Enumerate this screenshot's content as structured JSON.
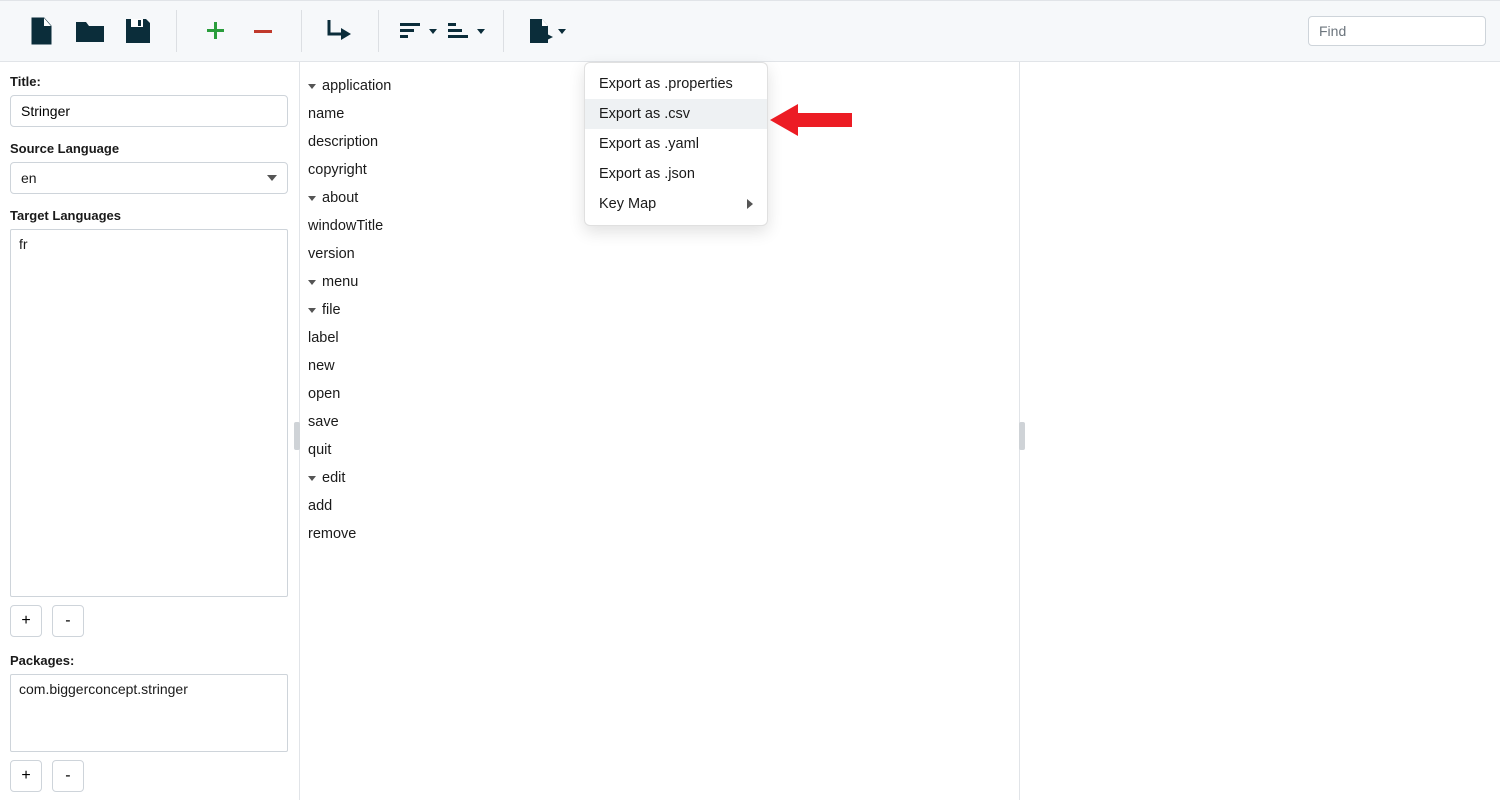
{
  "toolbar": {
    "find_placeholder": "Find"
  },
  "sidebar": {
    "title_label": "Title:",
    "title_value": "Stringer",
    "source_lang_label": "Source Language",
    "source_lang_value": "en",
    "target_lang_label": "Target Languages",
    "target_lang_items": [
      "fr"
    ],
    "add_label": "+",
    "remove_label": "-",
    "packages_label": "Packages:",
    "packages_items": [
      "com.biggerconcept.stringer"
    ]
  },
  "tree": {
    "items": [
      {
        "label": "application",
        "indent": "indent-0",
        "caret": true
      },
      {
        "label": "name",
        "indent": "indent-1",
        "caret": false
      },
      {
        "label": "description",
        "indent": "indent-1",
        "caret": false
      },
      {
        "label": "copyright",
        "indent": "indent-1",
        "caret": false
      },
      {
        "label": "about",
        "indent": "indent-1c",
        "caret": true
      },
      {
        "label": "windowTitle",
        "indent": "indent-2",
        "caret": false
      },
      {
        "label": "version",
        "indent": "indent-1",
        "caret": false
      },
      {
        "label": "menu",
        "indent": "indent-0",
        "caret": true
      },
      {
        "label": "file",
        "indent": "indent-1c",
        "caret": true
      },
      {
        "label": "label",
        "indent": "indent-2",
        "caret": false
      },
      {
        "label": "new",
        "indent": "indent-2",
        "caret": false
      },
      {
        "label": "open",
        "indent": "indent-2",
        "caret": false
      },
      {
        "label": "save",
        "indent": "indent-2",
        "caret": false
      },
      {
        "label": "quit",
        "indent": "indent-2",
        "caret": false
      },
      {
        "label": "edit",
        "indent": "indent-1c",
        "caret": true
      },
      {
        "label": "add",
        "indent": "indent-2",
        "caret": false
      },
      {
        "label": "remove",
        "indent": "indent-2",
        "caret": false
      }
    ]
  },
  "dropdown": {
    "items": [
      {
        "label": "Export as .properties",
        "hover": false,
        "submenu": false
      },
      {
        "label": "Export as .csv",
        "hover": true,
        "submenu": false
      },
      {
        "label": "Export as .yaml",
        "hover": false,
        "submenu": false
      },
      {
        "label": "Export as .json",
        "hover": false,
        "submenu": false
      },
      {
        "label": "Key Map",
        "hover": false,
        "submenu": true
      }
    ]
  }
}
